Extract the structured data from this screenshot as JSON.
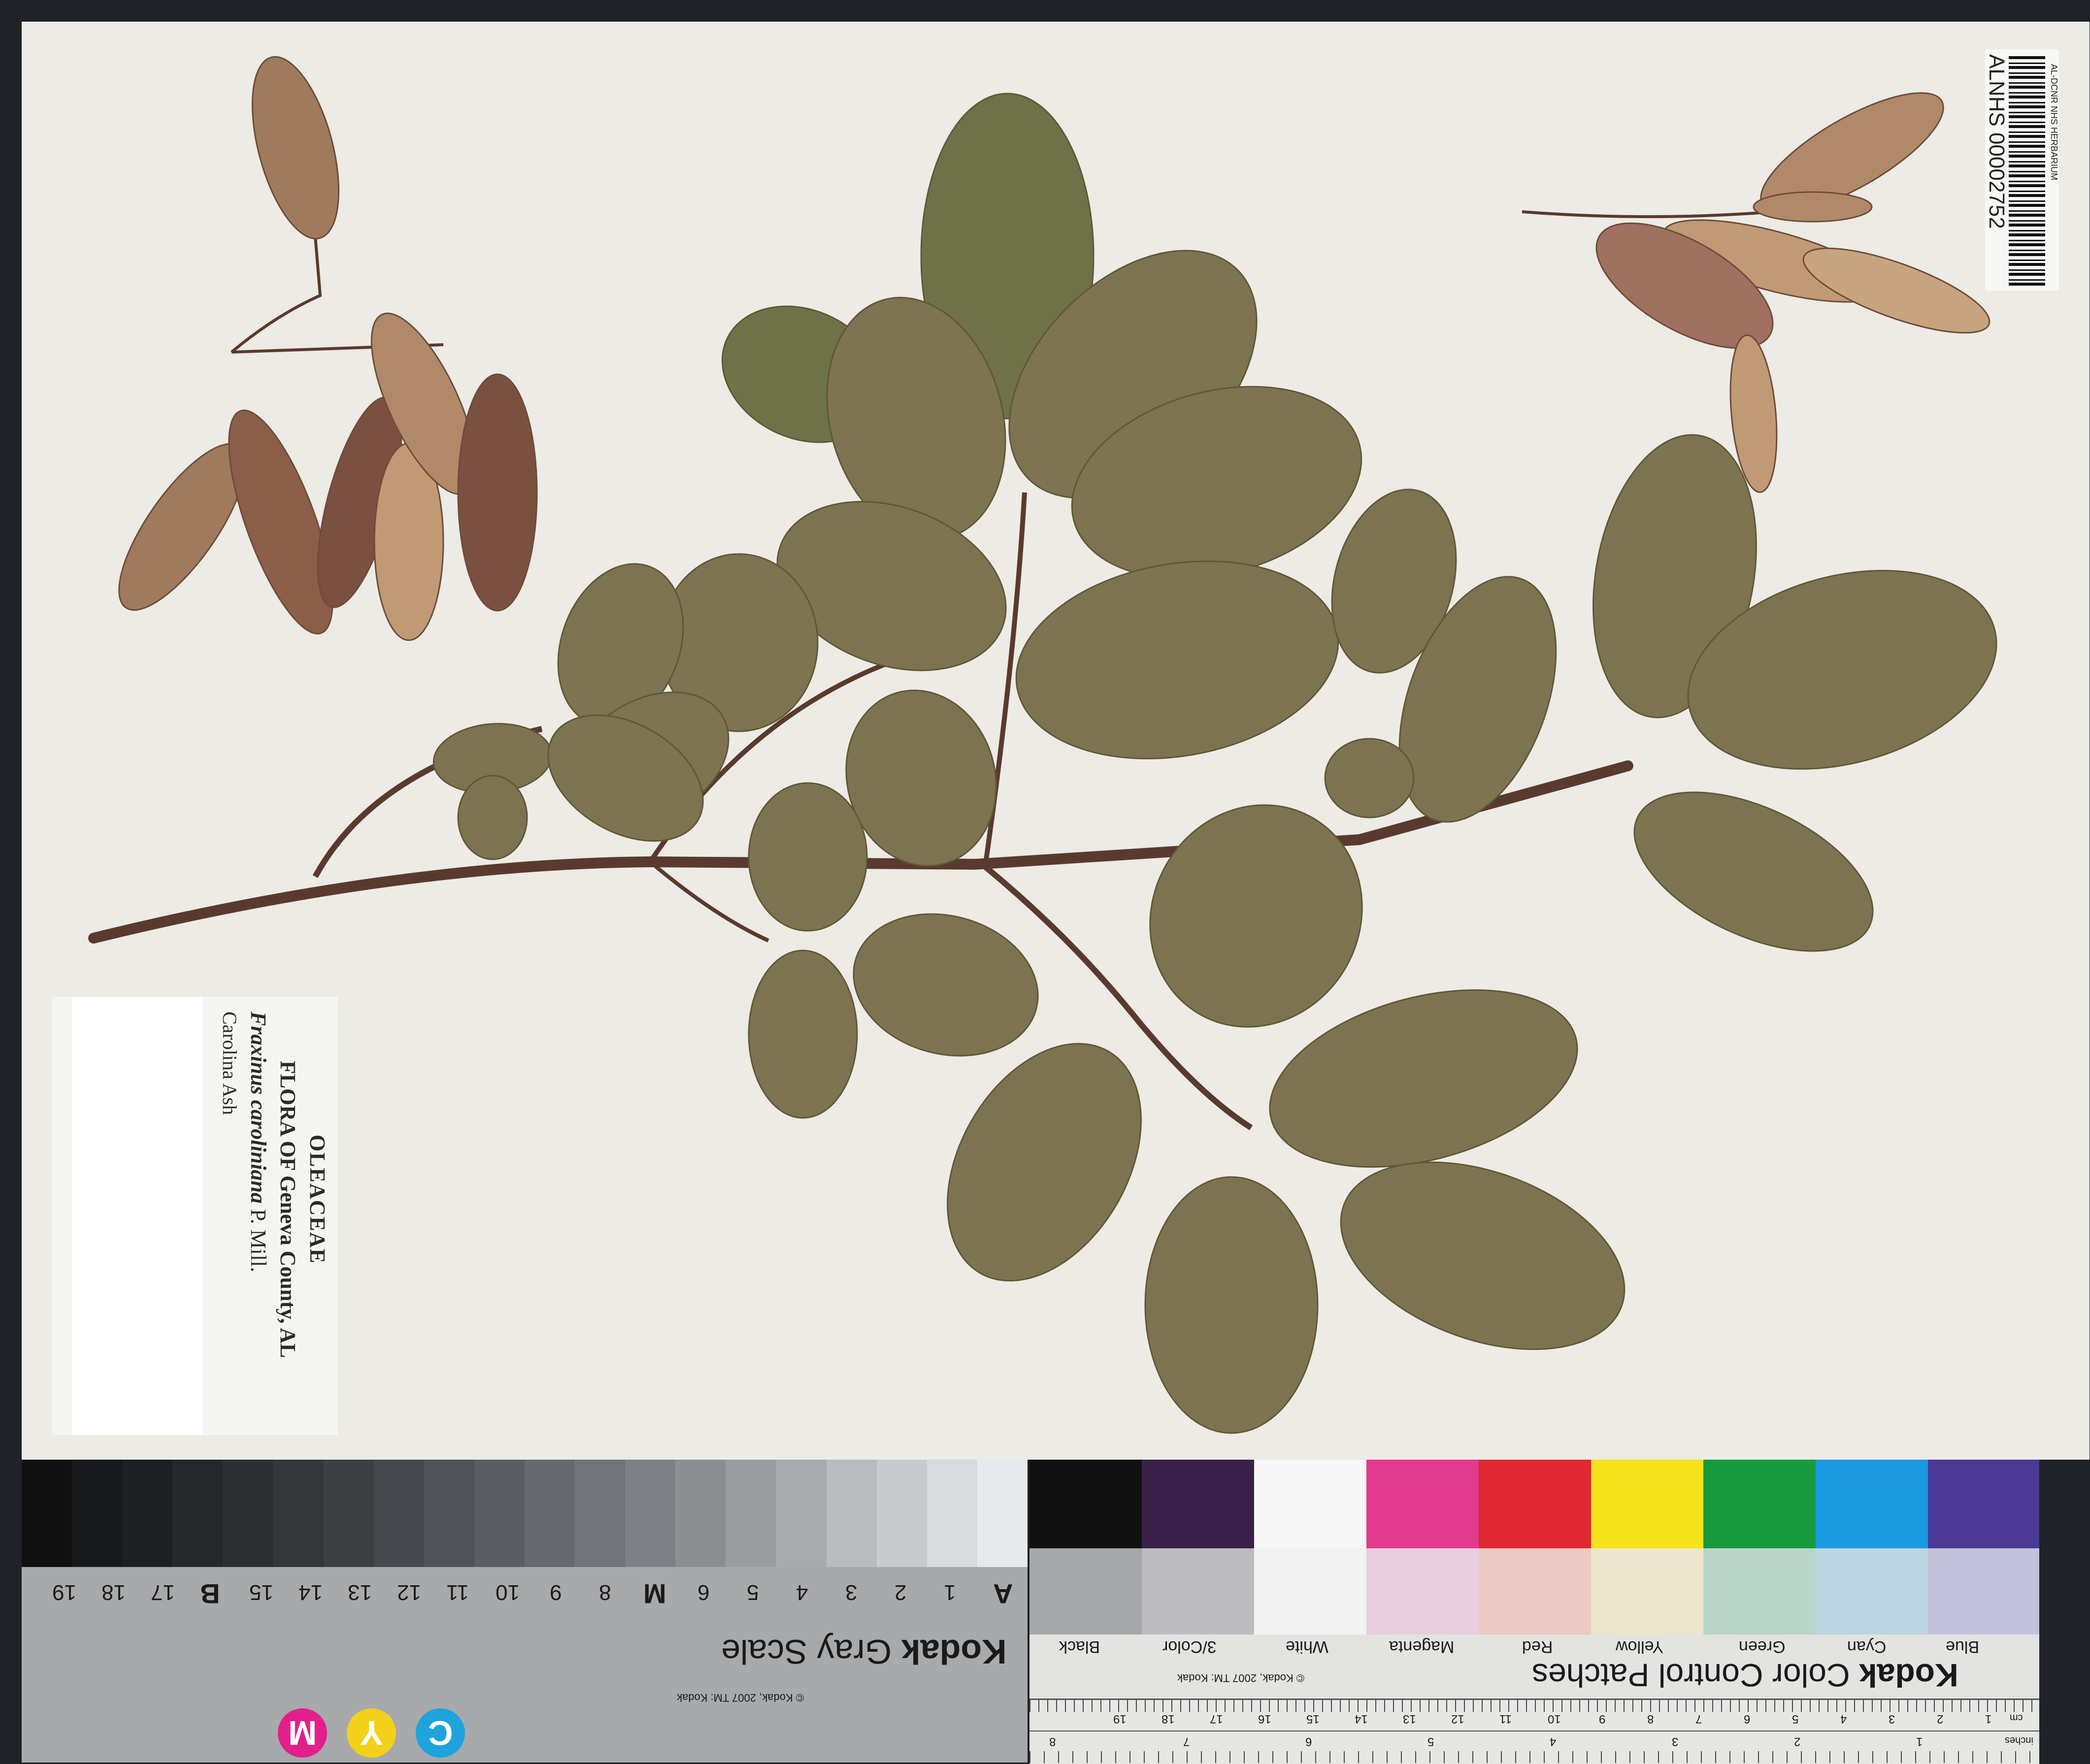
{
  "label": {
    "family": "OLEACEAE",
    "flora": "FLORA OF Geneva County, AL",
    "species": "Fraxinus caroliniana",
    "author": "P. Mill.",
    "common_name": "Carolina Ash"
  },
  "barcode": {
    "herbarium": "AL-DCNR NHS HERBARIUM",
    "catalog": "ALNHS 00002752"
  },
  "gray_card": {
    "brand": "Kodak",
    "title": "Gray Scale",
    "copyright": "© Kodak, 2007 TM: Kodak",
    "steps": [
      "A",
      "1",
      "2",
      "3",
      "4",
      "5",
      "6",
      "M",
      "8",
      "9",
      "10",
      "11",
      "12",
      "13",
      "14",
      "15",
      "B",
      "17",
      "18",
      "19"
    ],
    "cmy": [
      "C",
      "Y",
      "M"
    ]
  },
  "color_card": {
    "brand": "Kodak",
    "title": "Color Control Patches",
    "copyright": "© Kodak, 2007 TM: Kodak",
    "patch_names": [
      "Blue",
      "Cyan",
      "Green",
      "Yellow",
      "Red",
      "Magenta",
      "White",
      "3/Color",
      "Black"
    ],
    "ruler_cm": [
      "cm",
      "1",
      "2",
      "3",
      "4",
      "5",
      "6",
      "7",
      "8",
      "9",
      "10",
      "11",
      "12",
      "13",
      "14",
      "15",
      "16",
      "17",
      "18",
      "19"
    ],
    "ruler_in": [
      "inches",
      "1",
      "2",
      "3",
      "4",
      "5",
      "6",
      "7",
      "8"
    ]
  },
  "colors": {
    "paper": "#ecebe5",
    "leaf": "#7d7350",
    "leaf_dark": "#6b6442",
    "leaf_green": "#6e7248",
    "stem": "#5a3a2e",
    "samara": "#a07a5c",
    "samara_dark": "#7a5140"
  }
}
